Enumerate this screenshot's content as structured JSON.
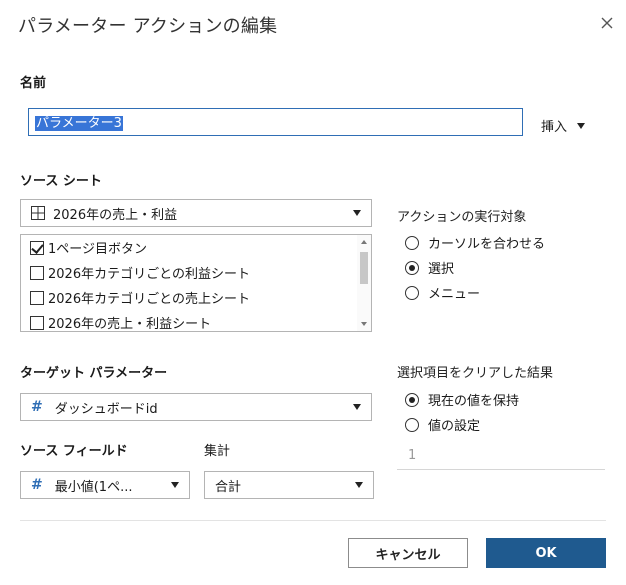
{
  "dialog": {
    "title": "パラメーター アクションの編集",
    "close_icon": "close-icon"
  },
  "name_section": {
    "label": "名前",
    "value": "パラメーター3",
    "insert_label": "挿入"
  },
  "source_sheet": {
    "label": "ソース シート",
    "selected": "2026年の売上・利益",
    "items": [
      {
        "label": "1ページ目ボタン",
        "checked": true
      },
      {
        "label": "2026年カテゴリごとの利益シート",
        "checked": false
      },
      {
        "label": "2026年カテゴリごとの売上シート",
        "checked": false
      },
      {
        "label": "2026年の売上・利益シート",
        "checked": false
      }
    ]
  },
  "run_action": {
    "label": "アクションの実行対象",
    "options": [
      {
        "label": "カーソルを合わせる",
        "selected": false
      },
      {
        "label": "選択",
        "selected": true
      },
      {
        "label": "メニュー",
        "selected": false
      }
    ]
  },
  "target_parameter": {
    "label": "ターゲット パラメーター",
    "value": "ダッシュボードid"
  },
  "source_field": {
    "label": "ソース フィールド",
    "value": "最小値(1ペ..."
  },
  "aggregation": {
    "label": "集計",
    "value": "合計"
  },
  "clear_result": {
    "label": "選択項目をクリアした結果",
    "options": [
      {
        "label": "現在の値を保持",
        "selected": true
      },
      {
        "label": "値の設定",
        "selected": false
      }
    ],
    "value_placeholder": "1"
  },
  "buttons": {
    "cancel": "キャンセル",
    "ok": "OK"
  },
  "colors": {
    "accent": "#1f5a8f",
    "selection": "#3875d7",
    "field_icon": "#2f6eb5"
  }
}
